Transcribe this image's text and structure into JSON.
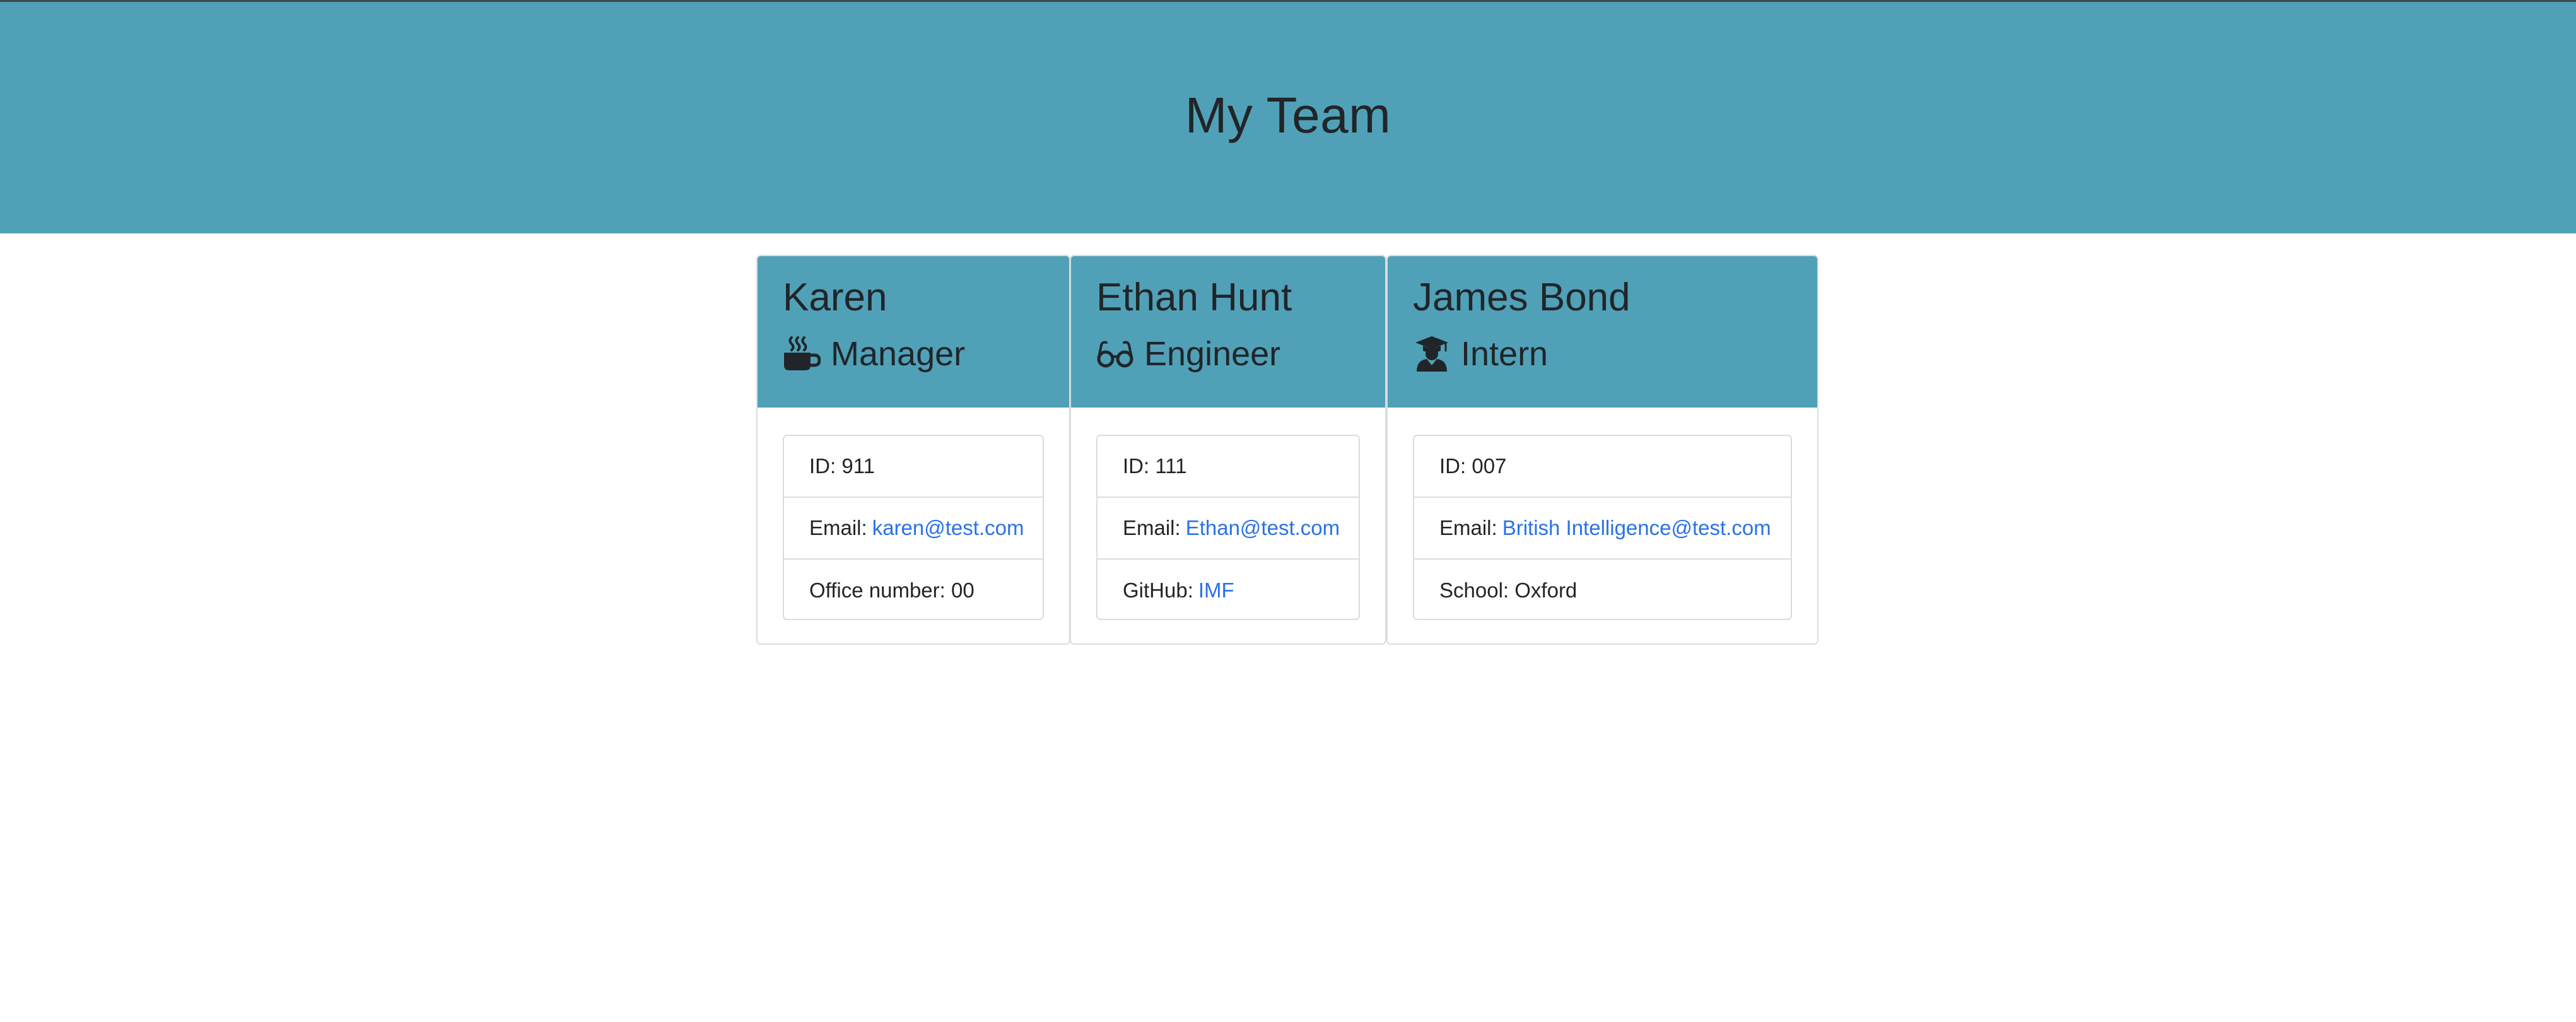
{
  "header": {
    "title": "My Team"
  },
  "team": [
    {
      "name": "Karen",
      "role": "Manager",
      "icon": "coffee-mug-icon",
      "id_label": "ID:",
      "id": "911",
      "email_label": "Email:",
      "email": "karen@test.com",
      "extra_label": "Office number:",
      "extra_value": "00"
    },
    {
      "name": "Ethan Hunt",
      "role": "Engineer",
      "icon": "glasses-icon",
      "id_label": "ID:",
      "id": "111",
      "email_label": "Email:",
      "email": "Ethan@test.com",
      "extra_label": "GitHub:",
      "extra_value": "IMF"
    },
    {
      "name": "James Bond",
      "role": "Intern",
      "icon": "graduate-icon",
      "id_label": "ID:",
      "id": "007",
      "email_label": "Email:",
      "email": "British Intelligence@test.com",
      "extra_label": "School:",
      "extra_value": "Oxford"
    }
  ],
  "colors": {
    "banner": "#50a1b7",
    "link": "#2a72e5",
    "border": "#d9dcdf"
  }
}
